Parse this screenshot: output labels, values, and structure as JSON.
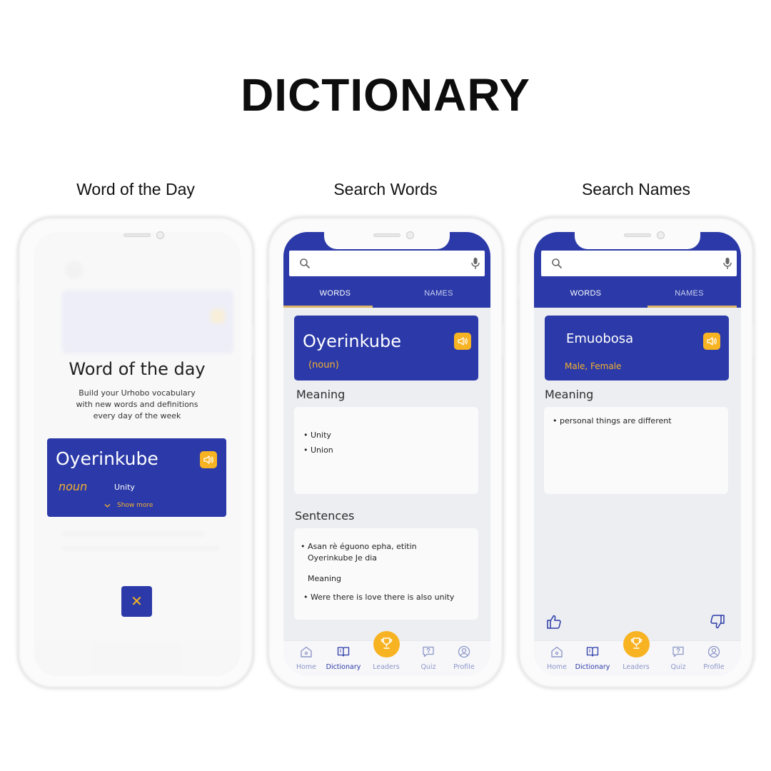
{
  "title": "DICTIONARY",
  "captions": [
    "Word of the Day",
    "Search Words",
    "Search Names"
  ],
  "word_of_day": {
    "heading": "Word of the day",
    "description": "Build your Urhobo vocabulary with new words and definitions every day of the week",
    "word": "Oyerinkube",
    "pos": "noun",
    "meaning": "Unity",
    "show_more": "Show more",
    "close_symbol": "✕"
  },
  "search_words": {
    "tabs": [
      "WORDS",
      "NAMES"
    ],
    "word": "Oyerinkube",
    "pos": "(noun)",
    "meaning_title": "Meaning",
    "meanings": [
      "Unity",
      "Union"
    ],
    "sentences_title": "Sentences",
    "sentence_line1": "Asan rè éguono epha, etitin",
    "sentence_line2": "Oyerinkube Je dia",
    "sentence_meaning_label": "Meaning",
    "sentence_meaning": "Were there is love there is also unity"
  },
  "search_names": {
    "tabs": [
      "WORDS",
      "NAMES"
    ],
    "name": "Emuobosa",
    "gender": "Male, Female",
    "meaning_title": "Meaning",
    "meanings": [
      "personal things are different"
    ]
  },
  "nav": [
    "Home",
    "Dictionary",
    "Leaders",
    "Quiz",
    "Profile"
  ],
  "colors": {
    "primary": "#2b3aa8",
    "accent": "#f8b323",
    "tab_underline": "#d9b46a"
  }
}
